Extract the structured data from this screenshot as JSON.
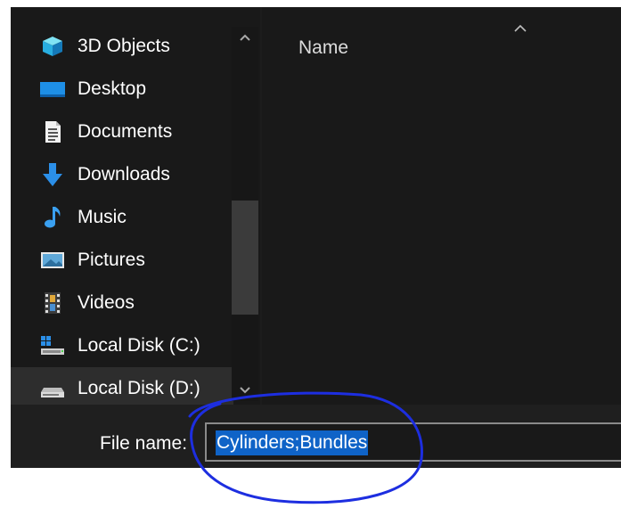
{
  "nav": {
    "items": [
      {
        "label": "3D Objects",
        "icon": "cube-icon"
      },
      {
        "label": "Desktop",
        "icon": "desktop-icon"
      },
      {
        "label": "Documents",
        "icon": "document-icon"
      },
      {
        "label": "Downloads",
        "icon": "download-arrow-icon"
      },
      {
        "label": "Music",
        "icon": "music-note-icon"
      },
      {
        "label": "Pictures",
        "icon": "picture-icon"
      },
      {
        "label": "Videos",
        "icon": "film-icon"
      },
      {
        "label": "Local Disk (C:)",
        "icon": "windows-drive-icon"
      },
      {
        "label": "Local Disk (D:)",
        "icon": "drive-icon",
        "selected": true
      }
    ]
  },
  "file_list": {
    "column_name": "Name",
    "sort_icon": "sort-up-icon"
  },
  "bottom_bar": {
    "filename_label": "File name:",
    "filename_value": "Cylinders;Bundles"
  },
  "colors": {
    "background": "#1c1c1c",
    "selection": "#0f63c7",
    "annotation": "#1d2ee0"
  }
}
